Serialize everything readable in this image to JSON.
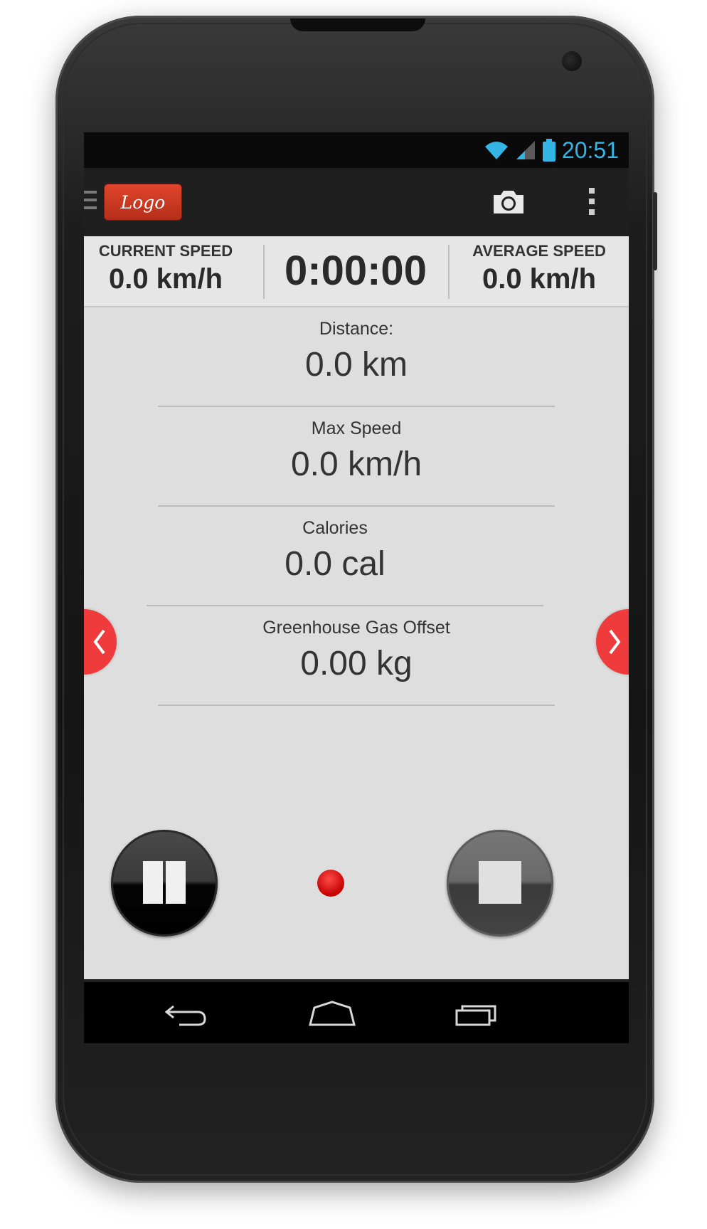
{
  "status_bar": {
    "time": "20:51",
    "icons": [
      "wifi-icon",
      "signal-icon",
      "battery-icon"
    ],
    "accent_color": "#33b5e5"
  },
  "action_bar": {
    "logo_text": "Logo",
    "icons": [
      "drawer-icon",
      "camera-icon",
      "overflow-menu-icon"
    ],
    "logo_color": "#c9351f"
  },
  "header": {
    "current_speed_label": "CURRENT SPEED",
    "current_speed_value": "0.0 km/h",
    "timer": "0:00:00",
    "average_speed_label": "AVERAGE SPEED",
    "average_speed_value": "0.0 km/h"
  },
  "metrics": [
    {
      "label": "Distance:",
      "value": "0.0 km"
    },
    {
      "label": "Max Speed",
      "value": "0.0 km/h"
    },
    {
      "label": "Calories",
      "value": "0.0 cal"
    },
    {
      "label": "Greenhouse Gas Offset",
      "value": "0.00 kg"
    }
  ],
  "controls": {
    "icons": [
      "pause-icon",
      "recording-indicator-icon",
      "stop-icon",
      "chevron-left-icon",
      "chevron-right-icon"
    ],
    "arrow_color": "#ef3b3b",
    "recording_color": "#d00000"
  },
  "navigation_bar": {
    "icons": [
      "back-icon",
      "home-icon",
      "recent-apps-icon"
    ]
  }
}
